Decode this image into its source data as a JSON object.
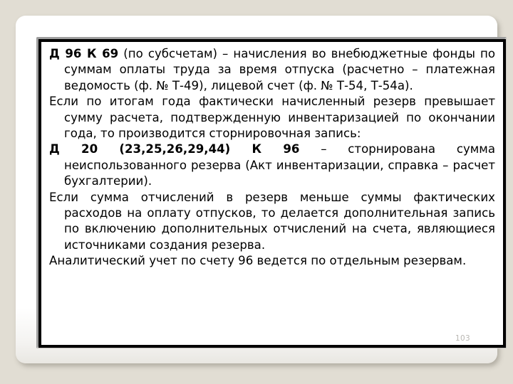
{
  "slide": {
    "page_number": "103",
    "background_color": "#e1ddd3",
    "card_color": "#ffffff",
    "frame_color": "#000000",
    "text_color": "#000000",
    "page_number_color": "#b9b7b2",
    "paragraphs": [
      {
        "id": "entry-d96-k69",
        "bold_prefix": "Д 96 К 69",
        "rest": " (по субсчетам) – начисления во внебюджетные фонды по суммам оплаты труда за время отпуска (расчетно – платежная ведомость (ф. № Т-49), лицевой счет (ф. № Т-54, Т-54а)."
      },
      {
        "id": "note-excess-reserve",
        "bold_prefix": "",
        "rest": "Если по итогам года фактически начисленный резерв превышает сумму расчета, подтвержденную инвентаризацией по окончании года, то производится сторнировочная запись:"
      },
      {
        "id": "entry-d20-k96",
        "bold_prefix": "Д 20 (23,25,26,29,44) К 96",
        "rest": " – сторнирована сумма неиспользованного резерва (Акт инвентаризации, справка – расчет бухгалтерии)."
      },
      {
        "id": "note-shortfall-reserve",
        "bold_prefix": "",
        "rest": "Если сумма отчислений в резерв меньше суммы фактических расходов на оплату отпусков, то делается дополнительная запись по включению дополнительных отчислений на счета, являющиеся источниками создания резерва."
      },
      {
        "id": "note-analytic-accounting",
        "bold_prefix": "",
        "rest": "Аналитический учет по счету 96 ведется по отдельным резервам."
      }
    ]
  }
}
